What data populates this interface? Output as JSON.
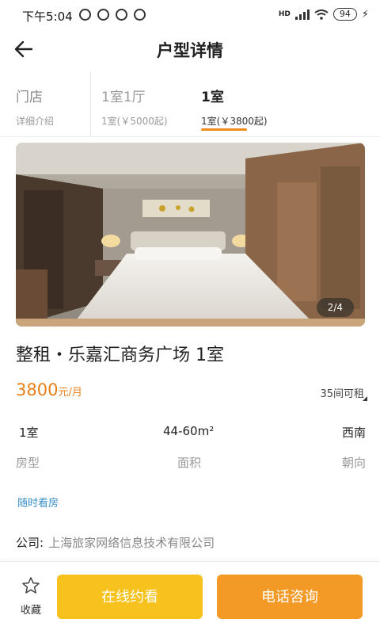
{
  "status_bar": {
    "time": "下午5:04",
    "battery": "94",
    "network": "HD"
  },
  "nav": {
    "title": "户型详情"
  },
  "room_tabs": [
    {
      "label": "门店",
      "sub": "详细介绍"
    },
    {
      "label": "1室1厅",
      "sub": "1室(￥5000起)"
    },
    {
      "label": "1室",
      "sub": "1室(￥3800起)"
    }
  ],
  "photo": {
    "counter": "2/4"
  },
  "listing": {
    "title": "整租・乐嘉汇商务广场 1室",
    "price": "3800",
    "price_unit": "元/月",
    "rooms_available": "35间可租"
  },
  "specs": {
    "type_value": "1室",
    "type_label": "房型",
    "area_value": "44-60m²",
    "area_label": "面积",
    "direction_value": "西南",
    "direction_label": "朝向"
  },
  "viewing_tag": "随时看房",
  "company": {
    "label": "公司:",
    "name": "上海旅家网络信息技术有限公司"
  },
  "bottom_bar": {
    "favorite_label": "收藏",
    "online_viewing": "在线约看",
    "phone_consult": "电话咨询"
  },
  "colors": {
    "accent_orange": "#f08a1c",
    "price_orange": "#e8801a",
    "button_yellow": "#f7c21d",
    "button_orange": "#f39a26",
    "tag_blue": "#3a8fc8"
  }
}
